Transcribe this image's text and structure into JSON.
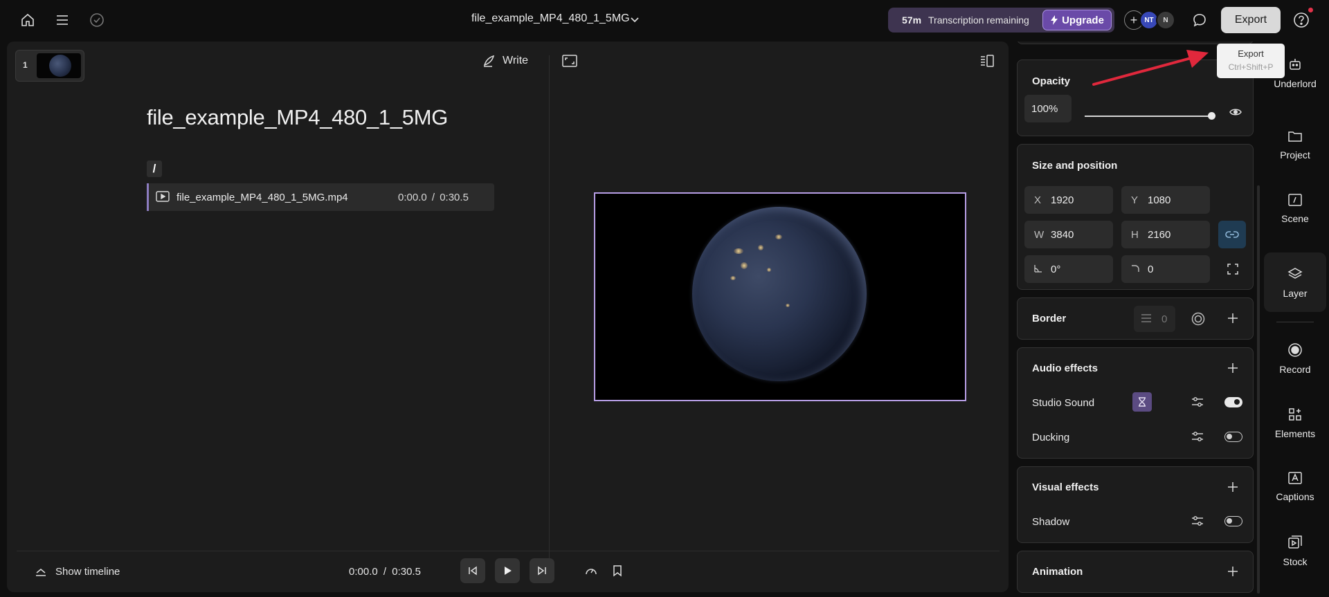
{
  "header": {
    "project_title": "file_example_MP4_480_1_5MG",
    "transcription_minutes": "57m",
    "transcription_label": "Transcription remaining",
    "upgrade_label": "Upgrade",
    "avatars": [
      "NT",
      "N"
    ],
    "export_label": "Export"
  },
  "tooltip": {
    "title": "Export",
    "shortcut": "Ctrl+Shift+P"
  },
  "script_editor": {
    "scene_number": "1",
    "write_label": "Write",
    "document_title": "file_example_MP4_480_1_5MG",
    "slash": "/",
    "clip": {
      "name": "file_example_MP4_480_1_5MG.mp4",
      "time": "0:00.0 / 0:30.5"
    }
  },
  "playback": {
    "show_timeline_label": "Show timeline",
    "current_time": "0:00.0",
    "separator": "/",
    "total_time": "0:30.5"
  },
  "properties": {
    "opacity": {
      "title": "Opacity",
      "value": "100%",
      "level": 1.0
    },
    "size_position": {
      "title": "Size and position",
      "x_label": "X",
      "x_value": "1920",
      "y_label": "Y",
      "y_value": "1080",
      "w_label": "W",
      "w_value": "3840",
      "h_label": "H",
      "h_value": "2160",
      "rotation_value": "0°",
      "corner_value": "0"
    },
    "border": {
      "title": "Border",
      "value": "0"
    },
    "audio_effects": {
      "title": "Audio effects",
      "studio_sound_label": "Studio Sound",
      "studio_sound_on": true,
      "ducking_label": "Ducking",
      "ducking_on": false
    },
    "visual_effects": {
      "title": "Visual effects",
      "shadow_label": "Shadow",
      "shadow_on": false
    },
    "animation": {
      "title": "Animation"
    }
  },
  "right_rail": {
    "items": [
      {
        "label": "Underlord",
        "icon": "robot-icon"
      },
      {
        "label": "Project",
        "icon": "folder-icon"
      },
      {
        "label": "Scene",
        "icon": "scene-icon"
      },
      {
        "label": "Layer",
        "icon": "layers-icon"
      },
      {
        "label": "Record",
        "icon": "record-icon"
      },
      {
        "label": "Elements",
        "icon": "elements-icon"
      },
      {
        "label": "Captions",
        "icon": "captions-icon"
      },
      {
        "label": "Stock",
        "icon": "stock-icon"
      }
    ],
    "active": "Layer"
  },
  "colors": {
    "accent_purple": "#6a4aa8",
    "selection_outline": "#b79ee6",
    "annotation_arrow": "#e0283c",
    "link_active": "#1f3b52"
  }
}
